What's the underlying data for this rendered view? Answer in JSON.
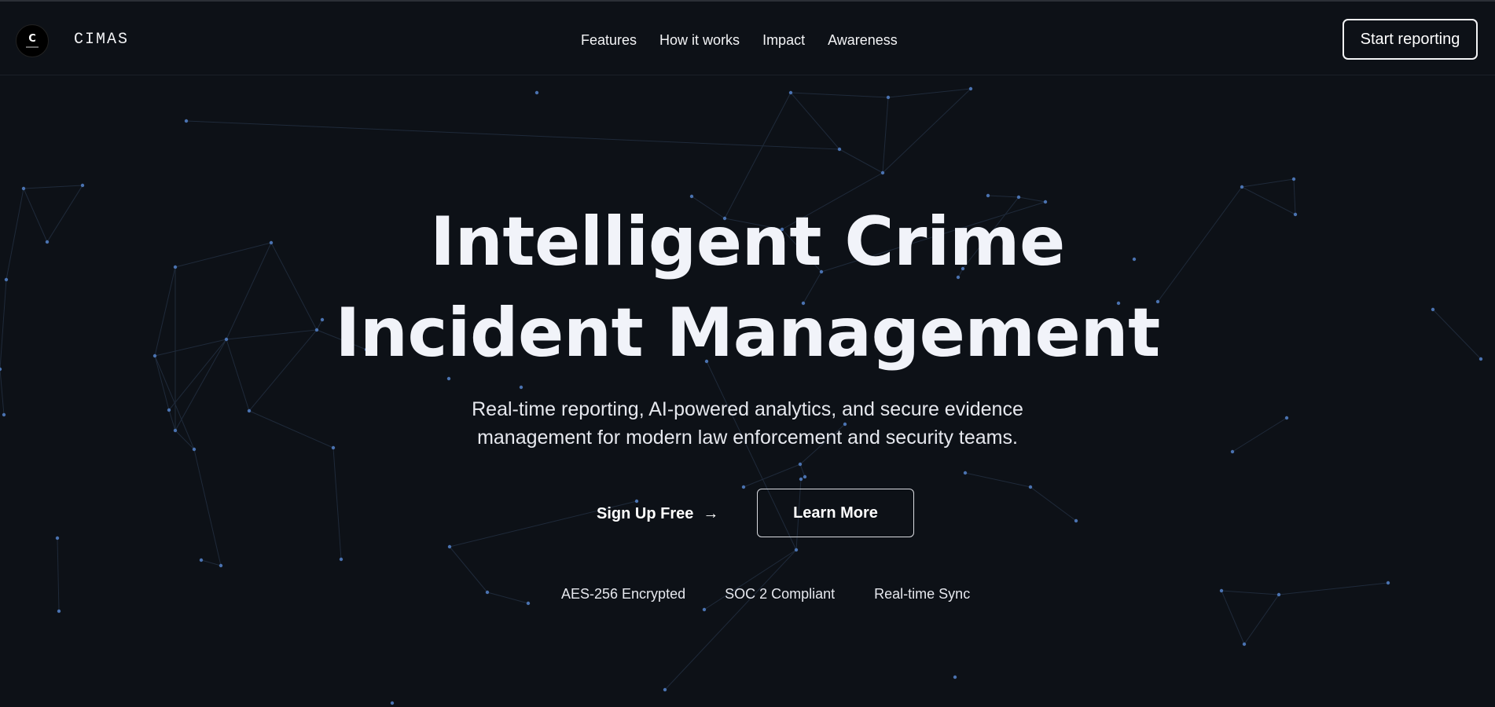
{
  "brand": {
    "logo_letter": "C",
    "name": "CIMAS"
  },
  "nav": {
    "items": [
      "Features",
      "How it works",
      "Impact",
      "Awareness"
    ],
    "cta": "Start reporting"
  },
  "hero": {
    "headline_line1": "Intelligent Crime",
    "headline_line2": "Incident Management",
    "subtitle_line1": "Real-time reporting, AI-powered analytics, and secure evidence",
    "subtitle_line2": "management for modern law enforcement and security teams.",
    "primary_button": "Sign Up Free",
    "primary_button_icon": "arrow-right-icon",
    "secondary_button": "Learn More",
    "badges": [
      "AES-256 Encrypted",
      "SOC 2 Compliant",
      "Real-time Sync"
    ]
  },
  "colors": {
    "background": "#0d1117",
    "text": "#f3f4f6",
    "node": "#4a72b0",
    "edge": "#1f2a3a"
  }
}
